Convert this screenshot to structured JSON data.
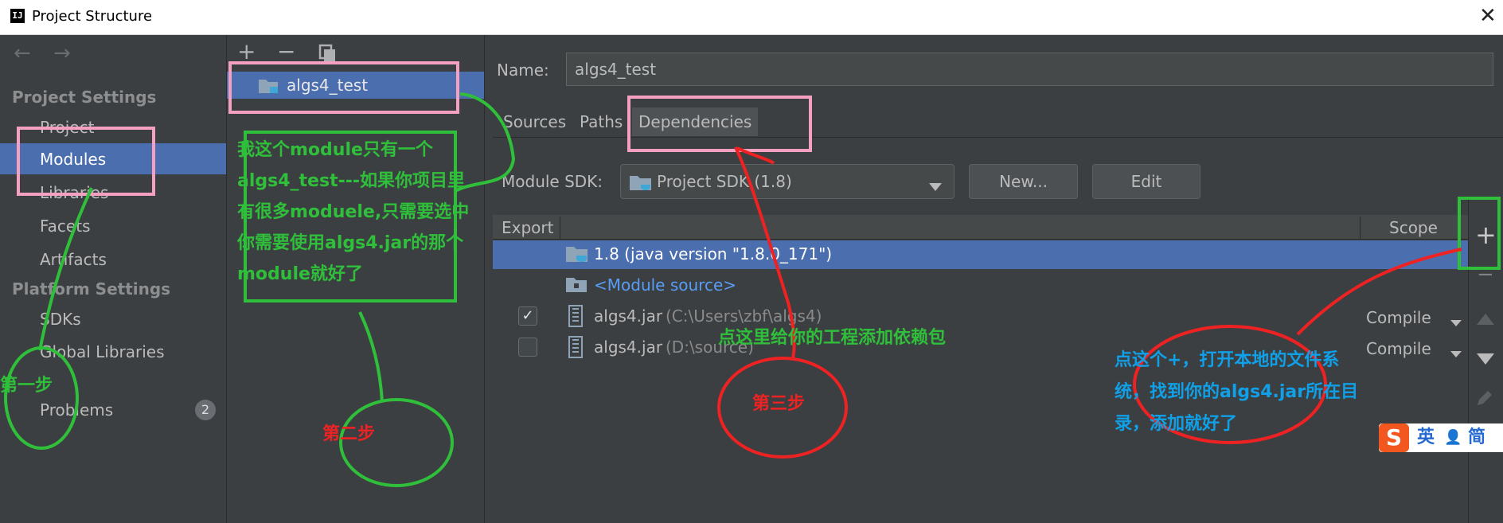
{
  "window": {
    "title": "Project Structure",
    "logo_text": "IJ"
  },
  "left_nav": {
    "section_project": "Project Settings",
    "project_items": [
      "Project",
      "Modules",
      "Libraries",
      "Facets",
      "Artifacts"
    ],
    "section_platform": "Platform Settings",
    "platform_items": [
      "SDKs",
      "Global Libraries"
    ],
    "problems": "Problems",
    "problems_count": "2",
    "selected": "Modules"
  },
  "module_list": {
    "items": [
      "algs4_test"
    ]
  },
  "module": {
    "name_label": "Name:",
    "name_value": "algs4_test",
    "tabs": [
      "Sources",
      "Paths",
      "Dependencies"
    ],
    "active_tab": "Dependencies",
    "sdk_label": "Module SDK:",
    "sdk_value": "Project SDK (1.8)",
    "new_button": "New...",
    "edit_button": "Edit",
    "table": {
      "col_export": "Export",
      "col_scope": "Scope",
      "rows": [
        {
          "name": "1.8 (java version \"1.8.0_171\")",
          "path": "",
          "checked": null,
          "scope": ""
        },
        {
          "name": "<Module source>",
          "path": "",
          "checked": null,
          "scope": ""
        },
        {
          "name": "algs4.jar",
          "path": "(C:\\Users\\zbf\\algs4)",
          "checked": true,
          "scope": "Compile"
        },
        {
          "name": "algs4.jar",
          "path": "(D:\\source)",
          "checked": false,
          "scope": "Compile"
        }
      ]
    }
  },
  "annotations": {
    "note_module_lines": [
      "我这个module只有一个",
      "algs4_test---如果你项目里",
      "有很多moduele,只需要选中",
      "你需要使用algs4.jar的那个",
      "module就好了"
    ],
    "step1": "第一步",
    "step2": "第二步",
    "step3": "第三步",
    "note_deps": "点这里给你的工程添加依赖包",
    "note_plus_lines": [
      "点这个+，打开本地的文件系",
      "统，找到你的algs4.jar所在目",
      "录，添加就好了"
    ]
  },
  "ime": {
    "lang": "英",
    "mode": "简"
  },
  "colors": {
    "selection": "#4b6eaf",
    "panel_bg": "#3c3f41",
    "annotation_green": "#2fbf3a",
    "annotation_red": "#ee2222",
    "annotation_blue": "#10a0e8",
    "highlight_pink": "#f5a0c0"
  }
}
